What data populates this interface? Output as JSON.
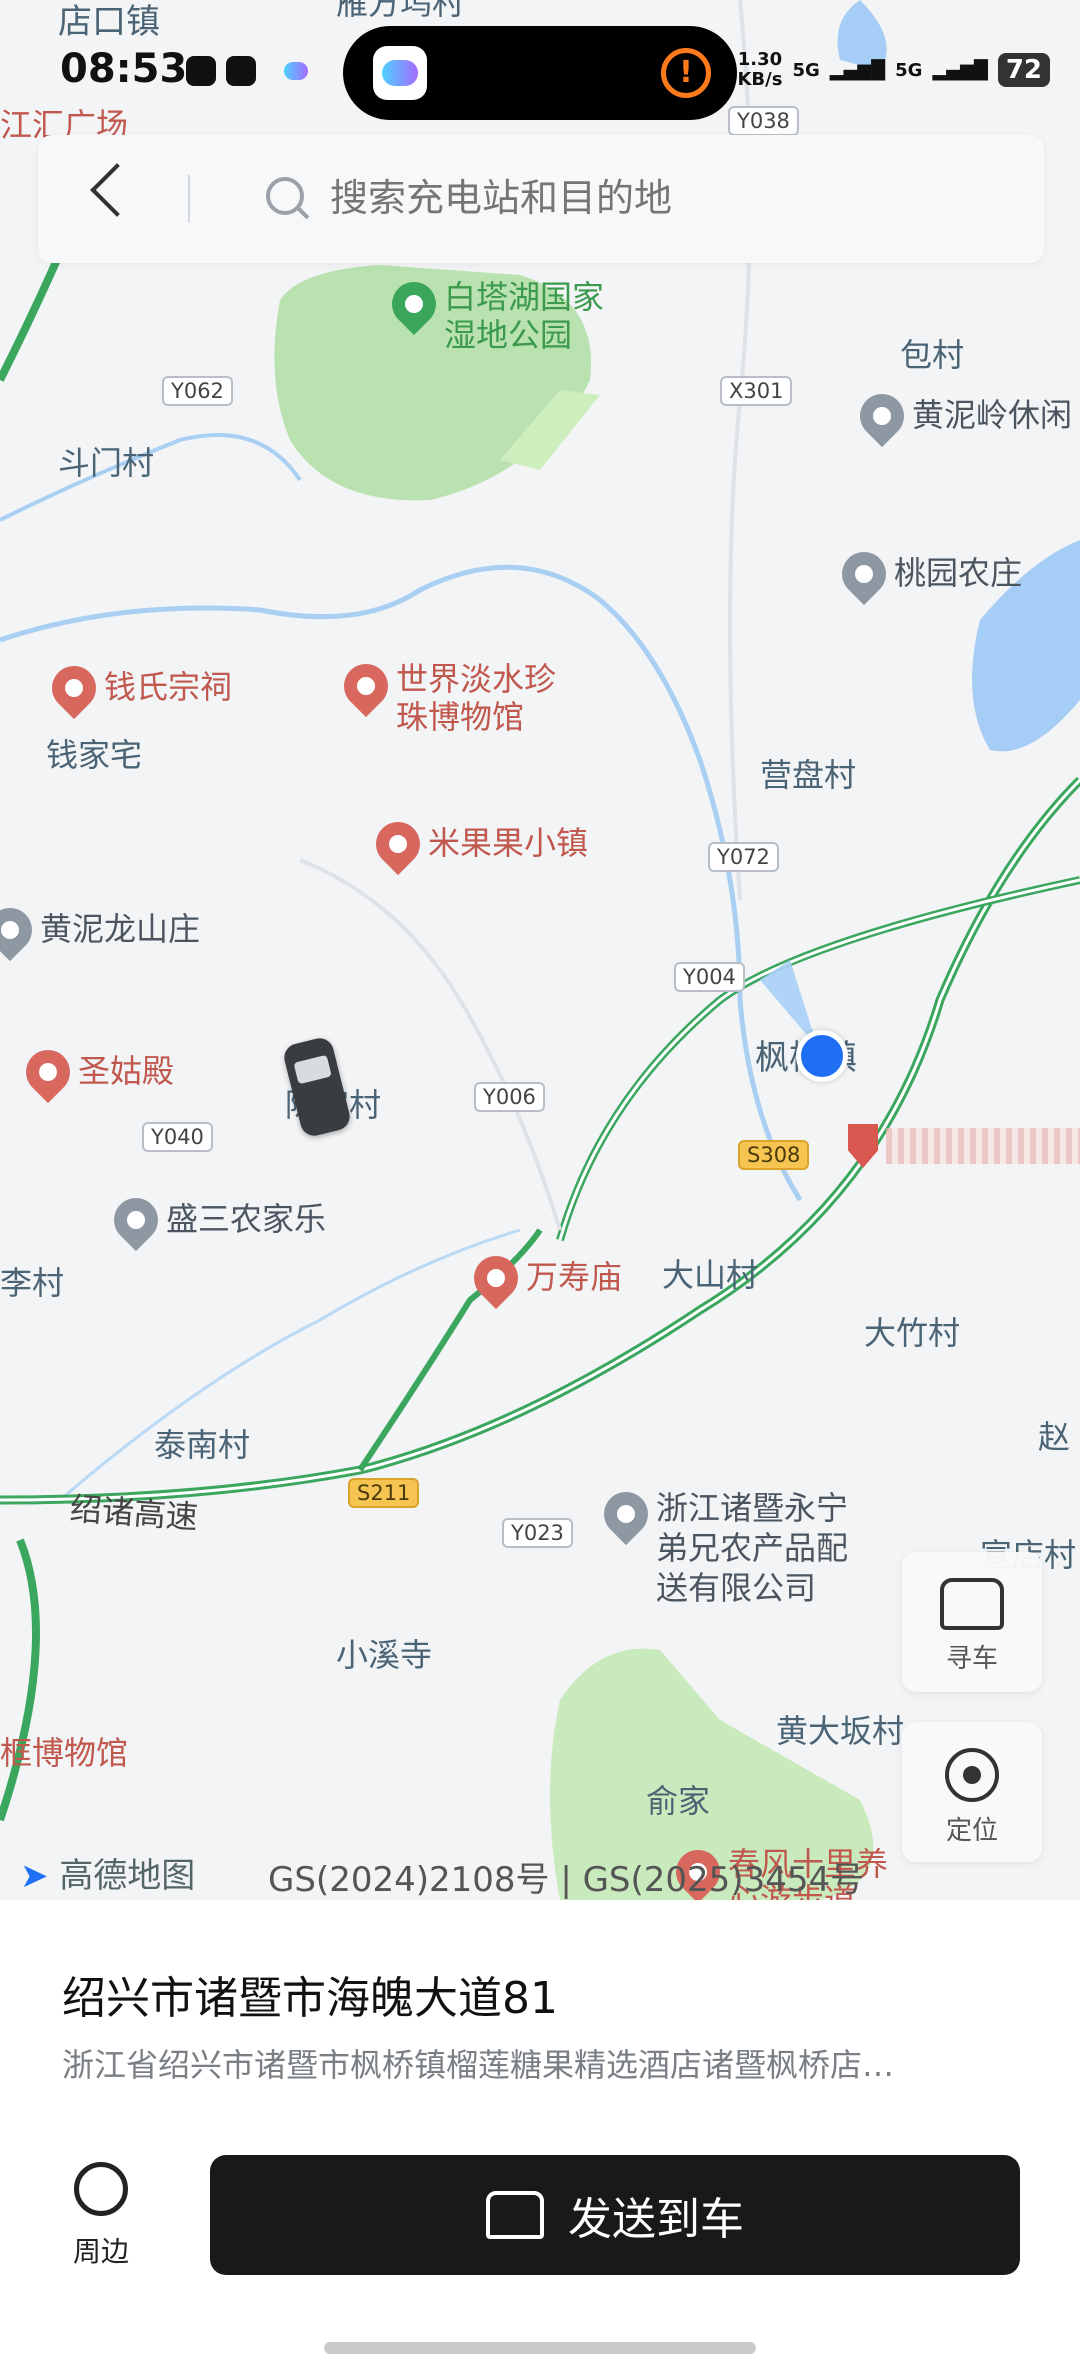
{
  "status_bar": {
    "time": "08:53",
    "net_speed_value": "1.30",
    "net_speed_unit": "KB/s",
    "signal1": "5G",
    "signal2": "5G",
    "battery": "72"
  },
  "search": {
    "placeholder": "搜索充电站和目的地"
  },
  "map": {
    "places": [
      {
        "id": "dianhou",
        "text": "店口镇"
      },
      {
        "id": "yanfang",
        "text": "雁方坞村"
      },
      {
        "id": "jianghui",
        "text": "江汇广场"
      },
      {
        "id": "doumen",
        "text": "斗门村"
      },
      {
        "id": "baocun",
        "text": "包村"
      },
      {
        "id": "qianjia",
        "text": "钱家宅"
      },
      {
        "id": "yingpan",
        "text": "营盘村"
      },
      {
        "id": "jiajia",
        "text": "陈家村"
      },
      {
        "id": "fengqiao",
        "text": "枫桥镇"
      },
      {
        "id": "licun",
        "text": "李村"
      },
      {
        "id": "dashan",
        "text": "大山村"
      },
      {
        "id": "dazhu",
        "text": "大竹村"
      },
      {
        "id": "tainan",
        "text": "泰南村"
      },
      {
        "id": "zhao",
        "text": "赵"
      },
      {
        "id": "xiaoxi",
        "text": "小溪寺"
      },
      {
        "id": "huangdaban",
        "text": "黄大坂村"
      },
      {
        "id": "yujia",
        "text": "俞家"
      },
      {
        "id": "xuantang",
        "text": "宣店村"
      },
      {
        "id": "expressway",
        "text": "绍诸高速"
      }
    ],
    "pois": [
      {
        "id": "baitahu",
        "text": "白塔湖国家\n湿地公园"
      },
      {
        "id": "huangniling",
        "text": "黄泥岭休闲"
      },
      {
        "id": "taoyuan",
        "text": "桃园农庄"
      },
      {
        "id": "qianshi",
        "text": "钱氏宗祠"
      },
      {
        "id": "shijie",
        "text": "世界淡水珍\n珠博物馆"
      },
      {
        "id": "miguoguo",
        "text": "米果果小镇"
      },
      {
        "id": "huangnilong",
        "text": "黄泥龙山庄"
      },
      {
        "id": "shenggu",
        "text": "圣姑殿"
      },
      {
        "id": "shengsan",
        "text": "盛三农家乐"
      },
      {
        "id": "wanshou",
        "text": "万寿庙"
      },
      {
        "id": "yongning",
        "text": "浙江诸暨永宁\n弟兄农产品配\n送有限公司"
      },
      {
        "id": "museum",
        "text": "框博物馆"
      },
      {
        "id": "chunfeng",
        "text": "春风十里养\n心游步道"
      }
    ],
    "roads": [
      "Y038",
      "Y062",
      "X301",
      "Y072",
      "Y004",
      "Y006",
      "Y040",
      "S308",
      "S211",
      "Y023"
    ],
    "watermark": "高德地图",
    "license": "GS(2024)2108号 | GS(2025)3454号"
  },
  "side_buttons": {
    "find_car": "寻车",
    "locate": "定位"
  },
  "sheet": {
    "title": "绍兴市诸暨市海魄大道81",
    "subtitle": "浙江省绍兴市诸暨市枫桥镇榴莲糖果精选酒店诸暨枫桥店…",
    "around_label": "周边",
    "send_label": "发送到车"
  }
}
